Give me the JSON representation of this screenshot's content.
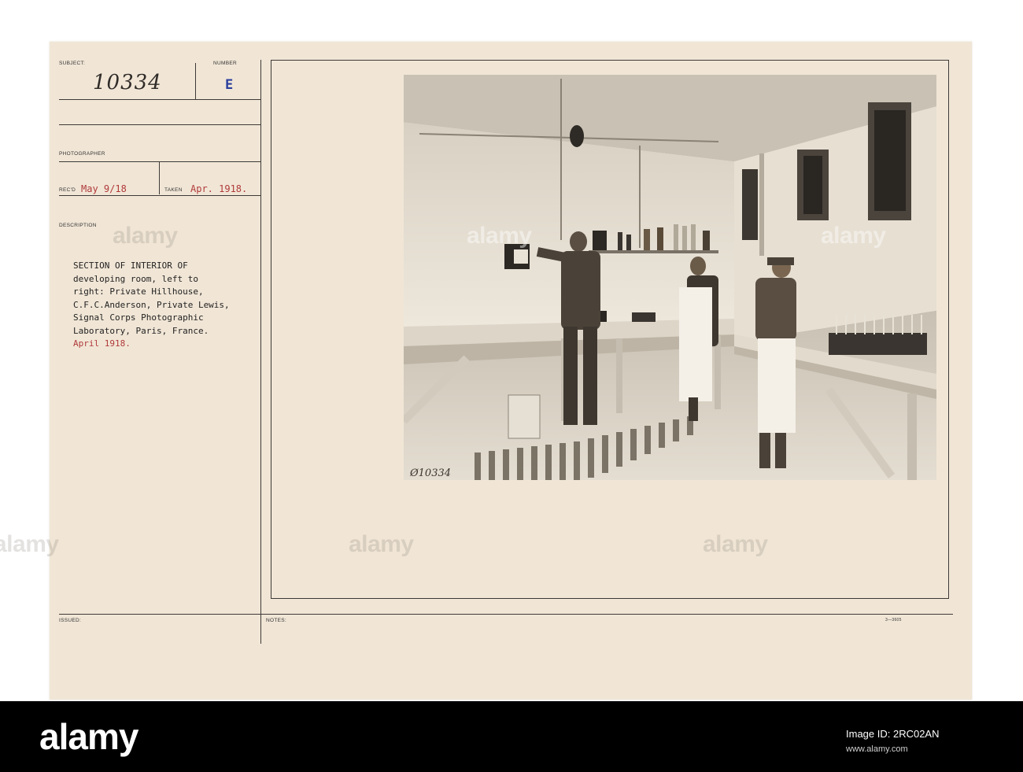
{
  "card": {
    "subject_label": "SUBJECT:",
    "number_label": "NUMBER",
    "subject_number": "10334",
    "series_letter": "E",
    "photographer_label": "PHOTOGRAPHER",
    "recd_label": "REC'D",
    "recd_date": "May 9/18",
    "taken_label": "TAKEN",
    "taken_date": "Apr. 1918.",
    "description_label": "DESCRIPTION",
    "description_lines": [
      "SECTION OF INTERIOR OF",
      "developing room, left to",
      "right: Private Hillhouse,",
      "C.F.C.Anderson, Private Lewis,",
      "Signal Corps Photographic",
      "Laboratory, Paris, France.",
      "April 1918."
    ],
    "issued_label": "ISSUED:",
    "notes_label": "NOTES:",
    "form_number": "3—3605",
    "photo_inscription": "Ø10334"
  },
  "watermarks": {
    "text": "alamy"
  },
  "footer": {
    "logo": "alamy",
    "image_id": "Image ID: 2RC02AN",
    "url": "www.alamy.com"
  }
}
